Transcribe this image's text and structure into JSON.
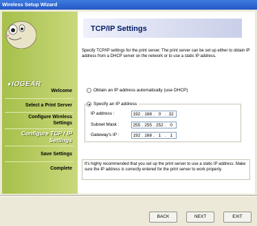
{
  "window": {
    "title": "Wireless Setup Wizard"
  },
  "brand": {
    "name": "IOGEAR"
  },
  "steps": [
    {
      "label": "Welcome"
    },
    {
      "label": "Select a Print Server"
    },
    {
      "label": "Configure Wireless Settings",
      "line1": "Configure Wireless",
      "line2": "Settings"
    },
    {
      "label": "Configure TCP / IP Settings",
      "line1": "Configure TCP / IP",
      "line2": "Settings",
      "active": true
    },
    {
      "label": "Save Settings"
    },
    {
      "label": "Complete"
    }
  ],
  "page": {
    "title": "TCP/IP Settings",
    "description": "Specify TCP/IP settings for the print server. The print server can be set up either to obtain IP address from a DHCP server on the network or to use a static IP address."
  },
  "options": {
    "dhcp_label": "Obtain an IP address automatically (use DHCP)",
    "static_label": "Specify an IP address",
    "selected": "static"
  },
  "fields": {
    "ip": {
      "label": "IP address :",
      "octets": [
        "192",
        "168",
        "0",
        "32"
      ]
    },
    "mask": {
      "label": "Subnet Mask :",
      "octets": [
        "255",
        "255",
        "252",
        "0"
      ]
    },
    "gateway": {
      "label": "Gateway's IP :",
      "octets": [
        "192",
        "168",
        "1",
        "1"
      ]
    }
  },
  "note": "It's highly recommended that you set up the print server to use a static IP address. Make sure the IP address is correctly entered for the print server to work properly.",
  "buttons": {
    "back": "BACK",
    "next": "NEXT",
    "exit": "EXIT"
  },
  "colors": {
    "titlebar": "#2457c5",
    "sidebar": "#a6c04a",
    "header_band": "#c9cfe9",
    "title_text": "#001a66"
  }
}
